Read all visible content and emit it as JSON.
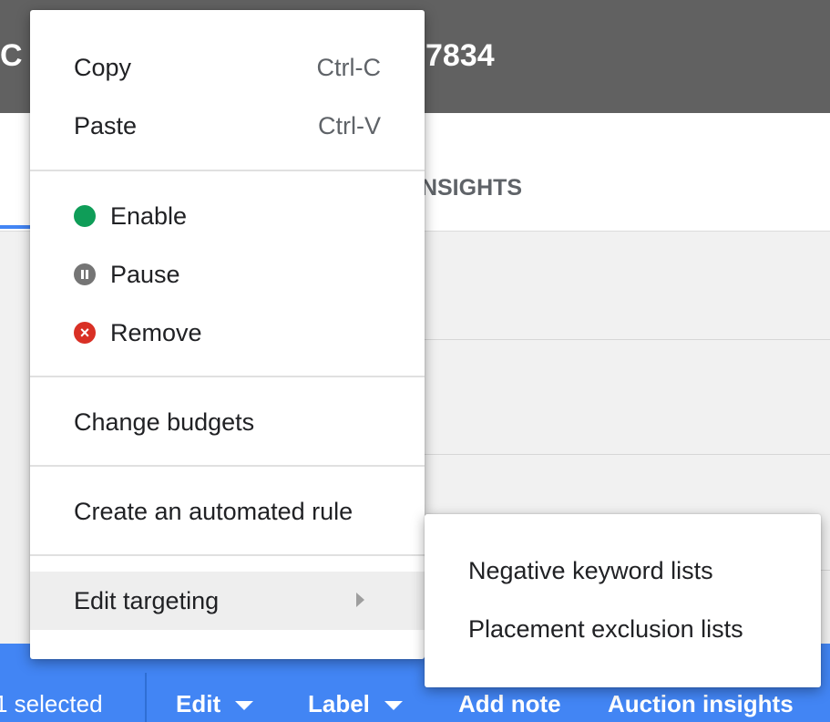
{
  "header": {
    "title_left": "C",
    "title_right": "7834"
  },
  "tabs": {
    "insights_label": "INSIGHTS"
  },
  "action_bar": {
    "selected_label": "1 selected",
    "edit_label": "Edit",
    "label_label": "Label",
    "add_note_label": "Add note",
    "auction_insights_label": "Auction insights"
  },
  "context_menu": {
    "copy": {
      "label": "Copy",
      "shortcut": "Ctrl-C"
    },
    "paste": {
      "label": "Paste",
      "shortcut": "Ctrl-V"
    },
    "enable": "Enable",
    "pause": "Pause",
    "remove": "Remove",
    "change_budgets": "Change budgets",
    "automated_rule": "Create an automated rule",
    "edit_targeting": "Edit targeting"
  },
  "submenu": {
    "negative_keyword_lists": "Negative keyword lists",
    "placement_exclusion_lists": "Placement exclusion lists"
  },
  "icons": {
    "enable": "green-dot-icon",
    "pause": "pause-icon",
    "remove": "remove-x-icon",
    "edit_targeting": "chevron-right-icon"
  },
  "colors": {
    "header_bg": "#616161",
    "action_bar_bg": "#4285f4",
    "enable_green": "#0f9d58",
    "pause_gray": "#757575",
    "remove_red": "#d93025"
  }
}
